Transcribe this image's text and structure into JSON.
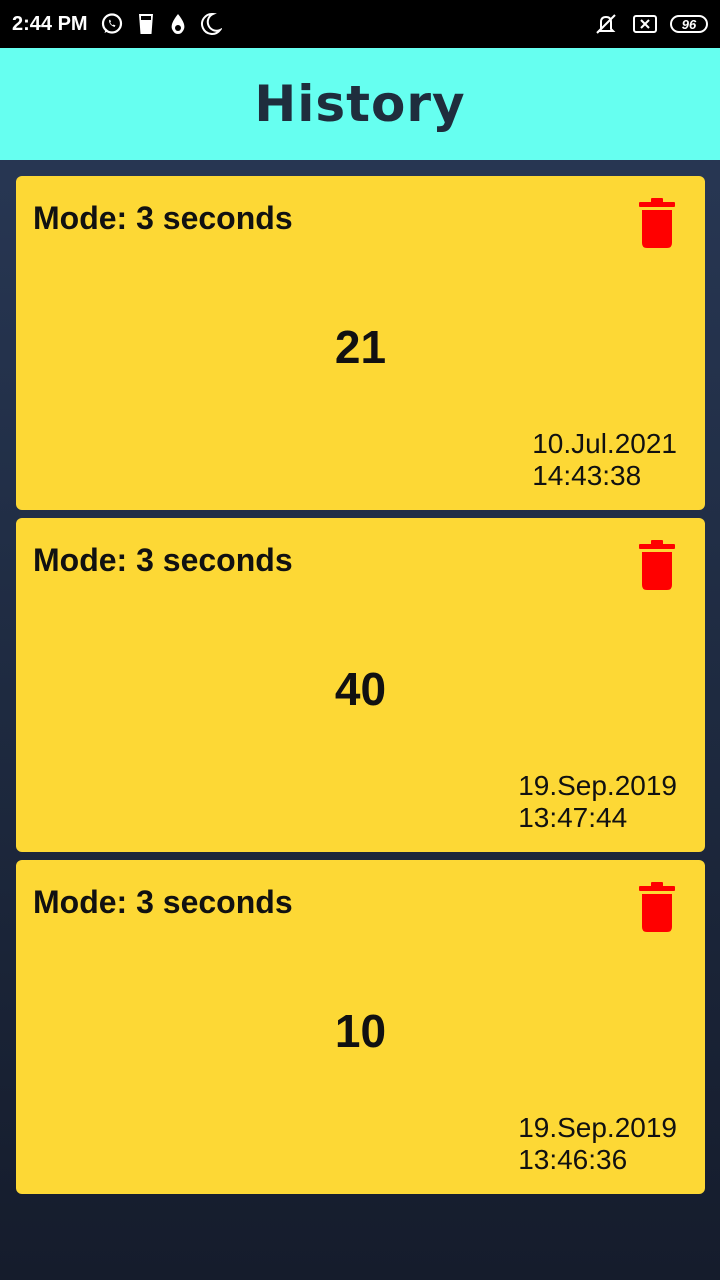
{
  "status_bar": {
    "time": "2:44 PM",
    "battery": "96",
    "icons": [
      "whatsapp-icon",
      "glass-icon",
      "drop-icon",
      "moon-icon",
      "mute-icon",
      "close-box-icon"
    ]
  },
  "header": {
    "title": "History"
  },
  "history": [
    {
      "mode": "Mode: 3 seconds",
      "score": "21",
      "date": "10.Jul.2021",
      "time": "14:43:38"
    },
    {
      "mode": "Mode: 3 seconds",
      "score": "40",
      "date": "19.Sep.2019",
      "time": "13:47:44"
    },
    {
      "mode": "Mode: 3 seconds",
      "score": "10",
      "date": "19.Sep.2019",
      "time": "13:46:36"
    }
  ],
  "colors": {
    "header_bg": "#66fff0",
    "title_color": "#1f2d3d",
    "card_bg": "#fdd835",
    "delete_icon": "#ff0000"
  }
}
